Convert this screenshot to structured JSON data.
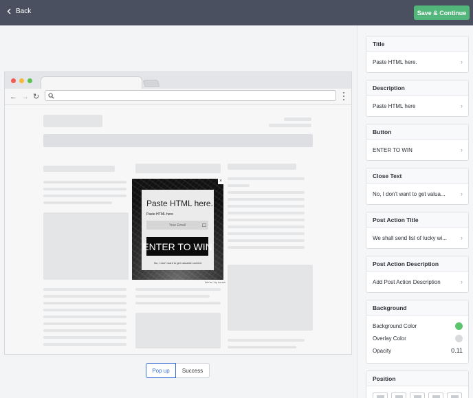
{
  "topbar": {
    "back_label": "Back",
    "save_label": "Save & Continue"
  },
  "preview": {
    "popup": {
      "title": "Paste HTML here.",
      "description": "Paste HTML here",
      "email_placeholder": "Your Email",
      "button": "ENTER TO WIN",
      "close_text": "No, I don't want to get valuable content",
      "credit": "We're / by Icrush"
    },
    "toggle": {
      "popup": "Pop up",
      "success": "Success",
      "active": "Pop up"
    }
  },
  "sidebar": {
    "title": {
      "header": "Title",
      "value": "Paste HTML here."
    },
    "description": {
      "header": "Description",
      "value": "Paste HTML here"
    },
    "button": {
      "header": "Button",
      "value": "ENTER TO WIN"
    },
    "close_text": {
      "header": "Close Text",
      "value": "No, I don't want to get valua..."
    },
    "post_action_title": {
      "header": "Post Action Title",
      "value": "We shall send list of lucky wi..."
    },
    "post_action_description": {
      "header": "Post Action Description",
      "value": "Add Post Action Description"
    },
    "background": {
      "header": "Background",
      "background_color_label": "Background Color",
      "overlay_color_label": "Overlay Color",
      "opacity_label": "Opacity",
      "opacity_value": "0.11",
      "background_color": "#5cc46d",
      "overlay_color": "#d9dadc"
    },
    "position": {
      "header": "Position"
    }
  },
  "colors": {
    "topbar": "#4a5060",
    "accent": "#52b57a",
    "toggle_active": "#3b6fd6"
  }
}
